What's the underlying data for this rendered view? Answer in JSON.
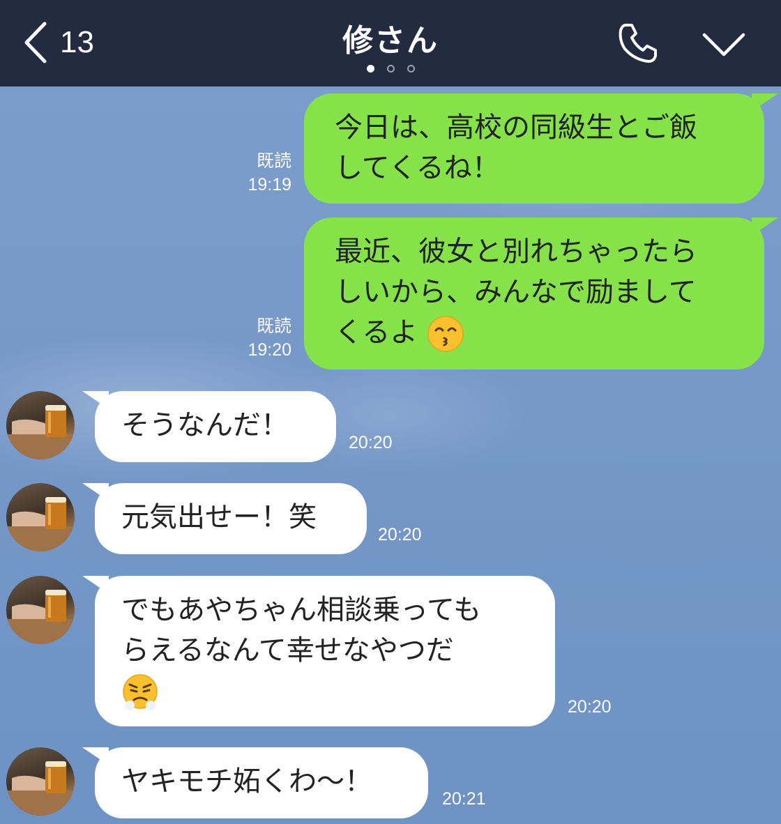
{
  "header": {
    "back_count": "13",
    "title": "修さん",
    "icons": [
      "chevron-left-icon",
      "phone-icon",
      "chevron-down-icon"
    ],
    "page_indicator": {
      "total": 3,
      "active": 1
    }
  },
  "messages": [
    {
      "side": "out",
      "read_label": "既読",
      "time": "19:19",
      "lines": [
        "今日は、高校の同級生とご飯",
        "してくるね！"
      ]
    },
    {
      "side": "out",
      "read_label": "既読",
      "time": "19:20",
      "lines": [
        "最近、彼女と別れちゃったら",
        "しいから、みんなで励まして",
        "くるよ"
      ],
      "emoji": "kissing-smiling-eyes-emoji"
    },
    {
      "side": "in",
      "time": "20:20",
      "lines": [
        "そうなんだ！"
      ]
    },
    {
      "side": "in",
      "time": "20:20",
      "lines": [
        "元気出せー！笑"
      ]
    },
    {
      "side": "in",
      "time": "20:20",
      "lines": [
        "でもあやちゃん相談乗っても",
        "らえるなんて幸せなやつだ"
      ],
      "emoji": "face-with-steam-from-nose-emoji"
    },
    {
      "side": "in",
      "time": "20:21",
      "lines": [
        "ヤキモチ妬くわ〜！"
      ]
    }
  ],
  "colors": {
    "header_bg": "#232b40",
    "chat_bg": "#7496c8",
    "outgoing_bubble": "#85e249",
    "incoming_bubble": "#ffffff"
  }
}
